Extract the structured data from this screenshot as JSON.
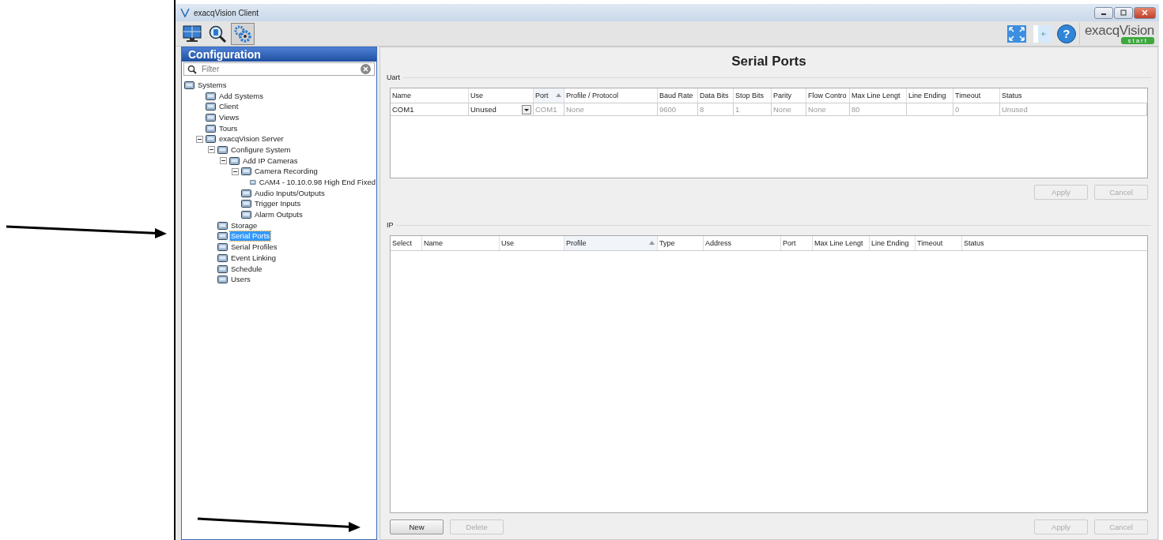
{
  "window": {
    "title": "exacqVision Client"
  },
  "toolbar": {
    "buttons": [
      {
        "selected": false
      },
      {
        "selected": false
      },
      {
        "selected": true
      }
    ]
  },
  "help": {
    "label": "?"
  },
  "logo": {
    "name": "exacqVision",
    "badge": "start"
  },
  "sidebar": {
    "title": "Configuration",
    "filter": {
      "placeholder": "Filter"
    },
    "tree": [
      {
        "label": "Systems",
        "selected": false,
        "children": [
          {
            "label": "Add Systems",
            "selected": false
          },
          {
            "label": "Client",
            "selected": false
          },
          {
            "label": "Views",
            "selected": false
          },
          {
            "label": "Tours",
            "selected": false
          },
          {
            "label": "exacqVision Server",
            "selected": false,
            "expanded": true,
            "children": [
              {
                "label": "Configure System",
                "selected": false,
                "expanded": true,
                "children": [
                  {
                    "label": "Add IP Cameras",
                    "selected": false,
                    "expanded": true,
                    "children": [
                      {
                        "label": "Camera Recording",
                        "selected": false,
                        "expanded": true,
                        "children": [
                          {
                            "label": "CAM4 - 10.10.0.98 High End Fixed",
                            "selected": false
                          }
                        ]
                      },
                      {
                        "label": "Audio Inputs/Outputs",
                        "selected": false
                      },
                      {
                        "label": "Trigger Inputs",
                        "selected": false
                      },
                      {
                        "label": "Alarm Outputs",
                        "selected": false
                      }
                    ]
                  }
                ]
              },
              {
                "label": "Storage",
                "selected": false
              },
              {
                "label": "Serial Ports",
                "selected": true
              },
              {
                "label": "Serial Profiles",
                "selected": false
              },
              {
                "label": "Event Linking",
                "selected": false
              },
              {
                "label": "Schedule",
                "selected": false
              },
              {
                "label": "Users",
                "selected": false
              }
            ]
          }
        ]
      }
    ]
  },
  "page": {
    "title": "Serial Ports"
  },
  "uart": {
    "label": "Uart",
    "columns": [
      {
        "label": "Name",
        "sorted": false
      },
      {
        "label": "Use",
        "sorted": false
      },
      {
        "label": "Port",
        "sorted": true
      },
      {
        "label": "Profile / Protocol",
        "sorted": false
      },
      {
        "label": "Baud Rate",
        "sorted": false
      },
      {
        "label": "Data Bits",
        "sorted": false
      },
      {
        "label": "Stop Bits",
        "sorted": false
      },
      {
        "label": "Parity",
        "sorted": false
      },
      {
        "label": "Flow Contro",
        "sorted": false
      },
      {
        "label": "Max Line Lengt",
        "sorted": false
      },
      {
        "label": "Line Ending",
        "sorted": false
      },
      {
        "label": "Timeout",
        "sorted": false
      },
      {
        "label": "Status",
        "sorted": false
      }
    ],
    "rows": [
      [
        {
          "text": "COM1",
          "disabled": false,
          "kind": "text"
        },
        {
          "text": "Unused",
          "disabled": false,
          "kind": "dropdown"
        },
        {
          "text": "COM1",
          "disabled": true,
          "kind": "text"
        },
        {
          "text": "None",
          "disabled": true,
          "kind": "text"
        },
        {
          "text": "9600",
          "disabled": true,
          "kind": "text"
        },
        {
          "text": "8",
          "disabled": true,
          "kind": "text"
        },
        {
          "text": "1",
          "disabled": true,
          "kind": "text"
        },
        {
          "text": "None",
          "disabled": true,
          "kind": "text"
        },
        {
          "text": "None",
          "disabled": true,
          "kind": "text"
        },
        {
          "text": "80",
          "disabled": true,
          "kind": "text"
        },
        {
          "kind": "text"
        },
        {
          "text": "0",
          "disabled": true,
          "kind": "text"
        },
        {
          "text": "Unused",
          "disabled": true,
          "kind": "text"
        }
      ]
    ],
    "buttons": [
      {
        "label": "Apply",
        "disabled": true
      },
      {
        "label": "Cancel",
        "disabled": true
      }
    ]
  },
  "ip": {
    "label": "IP",
    "columns": [
      {
        "label": "Select",
        "sorted": false
      },
      {
        "label": "Name",
        "sorted": false
      },
      {
        "label": "Use",
        "sorted": false
      },
      {
        "label": "Profile",
        "sorted": true
      },
      {
        "label": "Type",
        "sorted": false
      },
      {
        "label": "Address",
        "sorted": false
      },
      {
        "label": "Port",
        "sorted": false
      },
      {
        "label": "Max Line Lengt",
        "sorted": false
      },
      {
        "label": "Line Ending",
        "sorted": false
      },
      {
        "label": "Timeout",
        "sorted": false
      },
      {
        "label": "Status",
        "sorted": false
      }
    ],
    "left_buttons": [
      {
        "label": "New",
        "disabled": false
      },
      {
        "label": "Delete",
        "disabled": true
      }
    ],
    "buttons": [
      {
        "label": "Apply",
        "disabled": true
      },
      {
        "label": "Cancel",
        "disabled": true
      }
    ]
  }
}
